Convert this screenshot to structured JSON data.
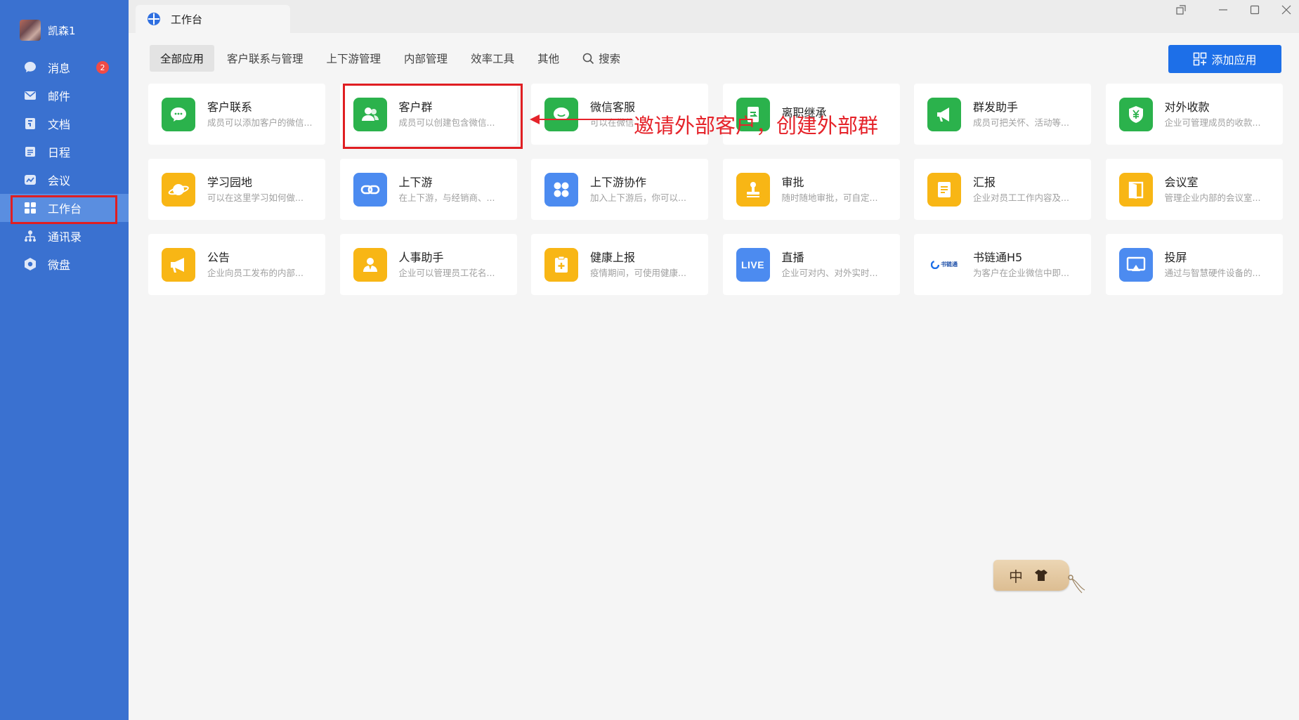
{
  "profile": {
    "name": "凯森1"
  },
  "nav": [
    {
      "label": "消息",
      "icon": "message-icon",
      "badge": "2"
    },
    {
      "label": "邮件",
      "icon": "mail-icon"
    },
    {
      "label": "文档",
      "icon": "document-icon"
    },
    {
      "label": "日程",
      "icon": "calendar-icon"
    },
    {
      "label": "会议",
      "icon": "meeting-icon"
    },
    {
      "label": "工作台",
      "icon": "workbench-icon",
      "active": true
    },
    {
      "label": "通讯录",
      "icon": "contacts-icon"
    },
    {
      "label": "微盘",
      "icon": "drive-icon"
    }
  ],
  "tab": {
    "title": "工作台"
  },
  "categories": [
    "全部应用",
    "客户联系与管理",
    "上下游管理",
    "内部管理",
    "效率工具",
    "其他"
  ],
  "search_label": "搜索",
  "add_app_label": "添加应用",
  "apps": [
    {
      "title": "客户联系",
      "desc": "成员可以添加客户的微信...",
      "icon": "wechat-bubble-icon",
      "color": "#2bb24c"
    },
    {
      "title": "客户群",
      "desc": "成员可以创建包含微信...",
      "icon": "customer-group-icon",
      "color": "#2bb24c"
    },
    {
      "title": "微信客服",
      "desc": "可以在微信",
      "icon": "wechat-service-icon",
      "color": "#2bb24c"
    },
    {
      "title": "离职继承",
      "desc": "",
      "icon": "resignation-icon",
      "color": "#2bb24c"
    },
    {
      "title": "群发助手",
      "desc": "成员可把关怀、活动等...",
      "icon": "megaphone-icon",
      "color": "#2bb24c"
    },
    {
      "title": "对外收款",
      "desc": "企业可管理成员的收款...",
      "icon": "yuan-shield-icon",
      "color": "#2bb24c"
    },
    {
      "title": "学习园地",
      "desc": "可以在这里学习如何做...",
      "icon": "planet-icon",
      "color": "#f8b615"
    },
    {
      "title": "上下游",
      "desc": "在上下游，与经销商、...",
      "icon": "chain-link-icon",
      "color": "#4c8bf0"
    },
    {
      "title": "上下游协作",
      "desc": "加入上下游后，你可以...",
      "icon": "four-dots-icon",
      "color": "#4c8bf0"
    },
    {
      "title": "审批",
      "desc": "随时随地审批，可自定...",
      "icon": "stamp-icon",
      "color": "#f8b615"
    },
    {
      "title": "汇报",
      "desc": "企业对员工工作内容及...",
      "icon": "report-icon",
      "color": "#f8b615"
    },
    {
      "title": "会议室",
      "desc": "管理企业内部的会议室...",
      "icon": "door-icon",
      "color": "#f8b615"
    },
    {
      "title": "公告",
      "desc": "企业向员工发布的内部...",
      "icon": "announcement-icon",
      "color": "#f8b615"
    },
    {
      "title": "人事助手",
      "desc": "企业可以管理员工花名...",
      "icon": "hr-person-icon",
      "color": "#f8b615"
    },
    {
      "title": "健康上报",
      "desc": "疫情期间，可使用健康...",
      "icon": "health-clipboard-icon",
      "color": "#f8b615"
    },
    {
      "title": "直播",
      "desc": "企业可对内、对外实时...",
      "icon": "live-icon",
      "color": "#4c8bf0",
      "icon_text": "LIVE"
    },
    {
      "title": "书链通H5",
      "desc": "为客户在企业微信中即...",
      "icon": "shuliantong-logo-icon",
      "color": "#ffffff",
      "icon_text": "书链通"
    },
    {
      "title": "投屏",
      "desc": "通过与智慧硬件设备的...",
      "icon": "screen-cast-icon",
      "color": "#4c8bf0"
    }
  ],
  "annotation": "邀请外部客户，创建外部群",
  "ime": {
    "mode": "中"
  },
  "colors": {
    "sidebar": "#3a71d0",
    "accent": "#1d6fe8",
    "highlight": "#e01e22",
    "green": "#2bb24c",
    "yellow": "#f8b615",
    "blue": "#4c8bf0"
  }
}
